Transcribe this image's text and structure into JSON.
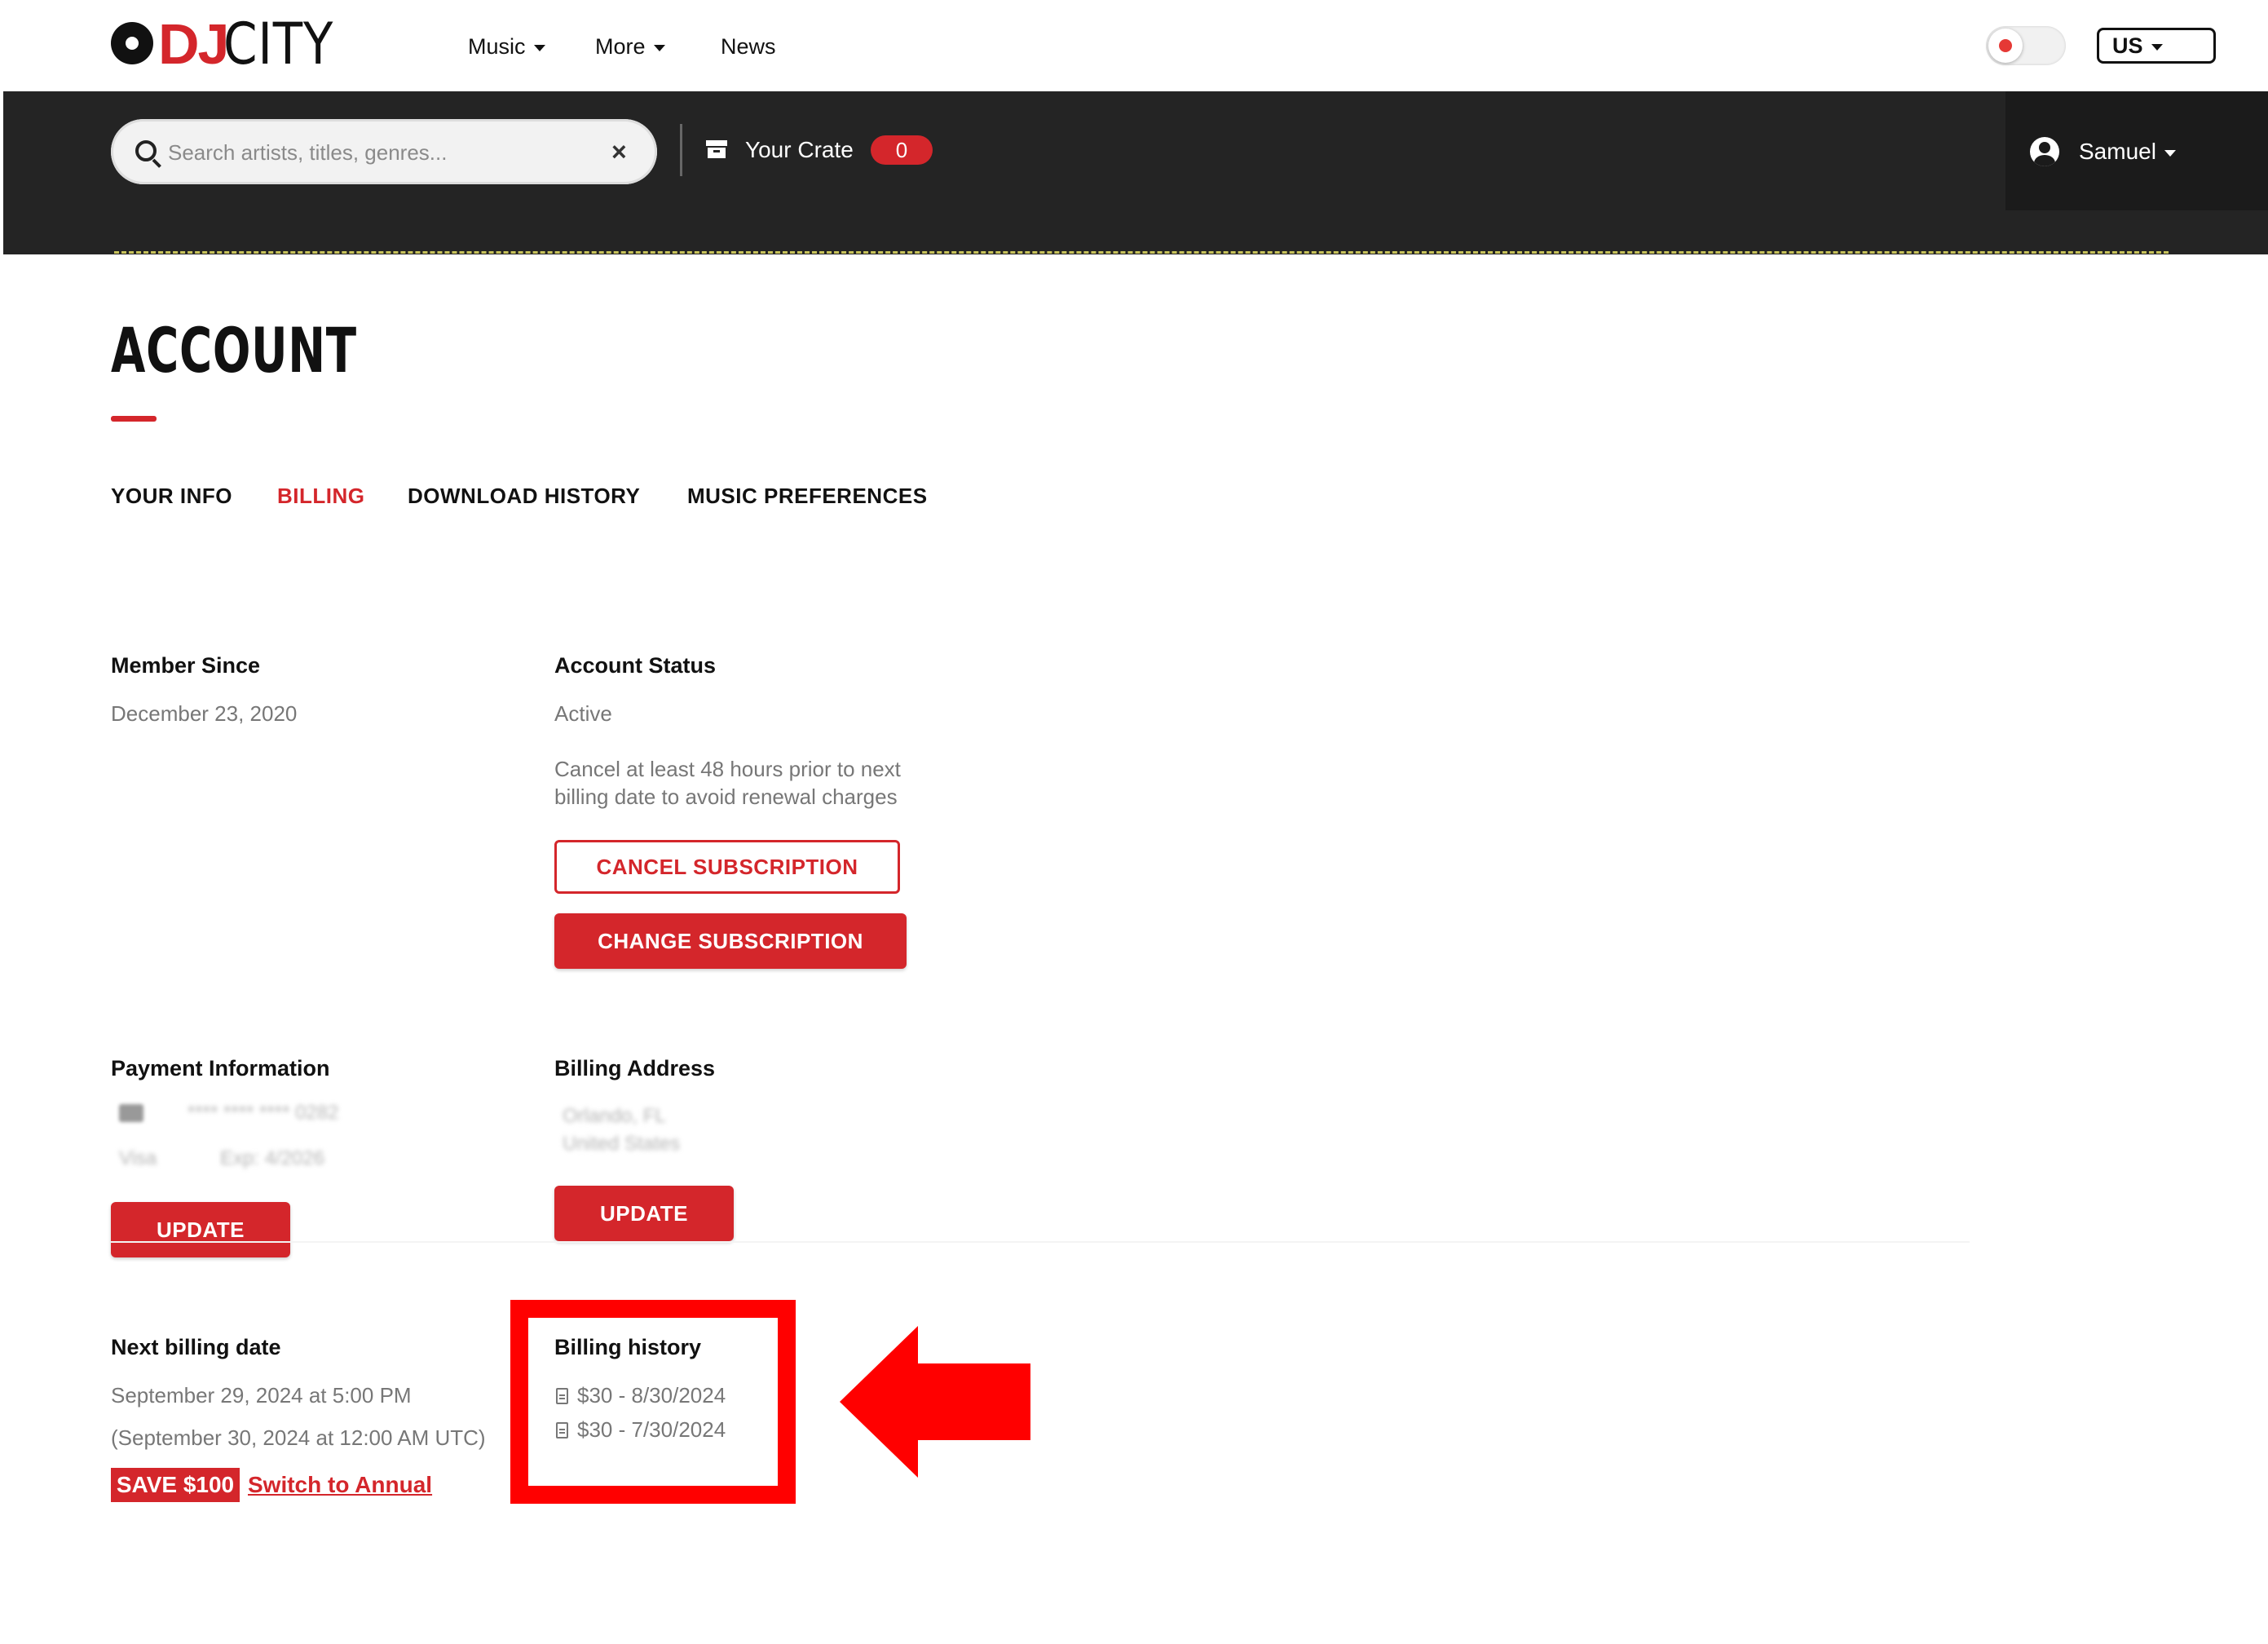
{
  "brand": {
    "logo_primary": "DJ",
    "logo_secondary": "CITY",
    "accent_color": "#d4262b"
  },
  "topnav": {
    "items": [
      {
        "label": "Music",
        "has_dropdown": true
      },
      {
        "label": "More",
        "has_dropdown": true
      },
      {
        "label": "News",
        "has_dropdown": false
      }
    ],
    "theme_toggle_icon": "sun-icon",
    "region": "US"
  },
  "toolbar": {
    "search_placeholder": "Search artists, titles, genres...",
    "search_clear": "×",
    "crate_label": "Your Crate",
    "crate_count": "0",
    "user_name": "Samuel"
  },
  "account": {
    "title": "ACCOUNT",
    "tabs": [
      {
        "label": "YOUR INFO",
        "active": false
      },
      {
        "label": "BILLING",
        "active": true
      },
      {
        "label": "DOWNLOAD HISTORY",
        "active": false
      },
      {
        "label": "MUSIC PREFERENCES",
        "active": false
      }
    ],
    "member_since": {
      "heading": "Member Since",
      "value": "December 23, 2020"
    },
    "account_status": {
      "heading": "Account Status",
      "value": "Active",
      "note_line1": "Cancel at least 48 hours prior to next",
      "note_line2": "billing date to avoid renewal charges",
      "cancel_button": "CANCEL SUBSCRIPTION",
      "change_button": "CHANGE SUBSCRIPTION"
    },
    "payment_information": {
      "heading": "Payment Information",
      "card_number": "**** **** **** 0282",
      "card_type": "Visa",
      "expiry": "Exp: 4/2026",
      "update_button": "UPDATE"
    },
    "billing_address": {
      "heading": "Billing Address",
      "line1": "Orlando, FL",
      "line2": "United States",
      "update_button": "UPDATE"
    },
    "next_billing": {
      "heading": "Next billing date",
      "local": "September 29, 2024 at 5:00 PM",
      "utc": "(September 30, 2024 at 12:00 AM UTC)",
      "save_badge": "SAVE $100",
      "switch_link": "Switch to Annual"
    },
    "billing_history": {
      "heading": "Billing history",
      "entries": [
        "$30 - 8/30/2024",
        "$30 - 7/30/2024"
      ]
    }
  },
  "annotation": {
    "color": "#ff0000"
  }
}
